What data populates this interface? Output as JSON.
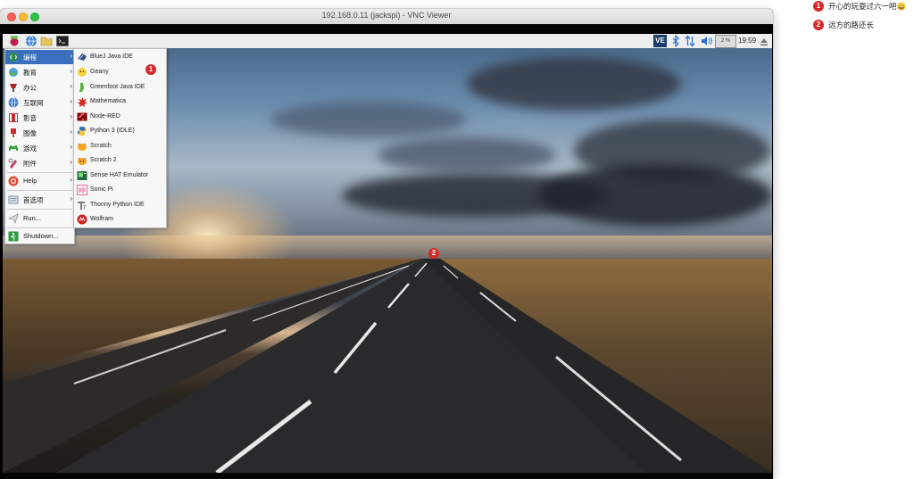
{
  "window": {
    "title": "192.168.0.11 (jackspi) - VNC Viewer"
  },
  "taskbar": {
    "launchers": [
      "raspberry-menu",
      "web-browser",
      "file-manager",
      "terminal"
    ],
    "tray": {
      "vnc_label": "VE",
      "cpu_label": "2 %",
      "clock": "19:59"
    }
  },
  "start_menu": {
    "items": [
      {
        "label": "编程",
        "icon": "programming-icon",
        "has_submenu": true,
        "selected": true
      },
      {
        "label": "教育",
        "icon": "education-icon",
        "has_submenu": true
      },
      {
        "label": "办公",
        "icon": "office-icon",
        "has_submenu": true
      },
      {
        "label": "互联网",
        "icon": "internet-icon",
        "has_submenu": true
      },
      {
        "label": "影音",
        "icon": "media-icon",
        "has_submenu": true
      },
      {
        "label": "图像",
        "icon": "graphics-icon",
        "has_submenu": true
      },
      {
        "label": "游戏",
        "icon": "games-icon",
        "has_submenu": true
      },
      {
        "label": "附件",
        "icon": "accessories-icon",
        "has_submenu": true
      },
      {
        "label": "Help",
        "icon": "help-icon",
        "has_submenu": true
      },
      {
        "label": "首选项",
        "icon": "preferences-icon",
        "has_submenu": true
      },
      {
        "label": "Run...",
        "icon": "run-icon",
        "has_submenu": false
      },
      {
        "label": "Shutdown...",
        "icon": "shutdown-icon",
        "has_submenu": false
      }
    ]
  },
  "submenu": {
    "items": [
      {
        "label": "BlueJ Java IDE",
        "icon": "bluej-icon"
      },
      {
        "label": "Geany",
        "icon": "geany-icon"
      },
      {
        "label": "Greenfoot Java IDE",
        "icon": "greenfoot-icon"
      },
      {
        "label": "Mathematica",
        "icon": "mathematica-icon"
      },
      {
        "label": "Node-RED",
        "icon": "node-red-icon"
      },
      {
        "label": "Python 3 (IDLE)",
        "icon": "python-icon"
      },
      {
        "label": "Scratch",
        "icon": "scratch-icon"
      },
      {
        "label": "Scratch 2",
        "icon": "scratch2-icon"
      },
      {
        "label": "Sense HAT Emulator",
        "icon": "sense-hat-icon"
      },
      {
        "label": "Sonic Pi",
        "icon": "sonic-pi-icon"
      },
      {
        "label": "Thonny Python IDE",
        "icon": "thonny-icon"
      },
      {
        "label": "Wolfram",
        "icon": "wolfram-icon"
      }
    ]
  },
  "annotations": [
    {
      "number": "1",
      "text": "开心的玩耍过六一吧😄"
    },
    {
      "number": "2",
      "text": "远方的路还长"
    }
  ],
  "colors": {
    "menu_selected": "#3a6fbf",
    "badge": "#d42a2a"
  }
}
